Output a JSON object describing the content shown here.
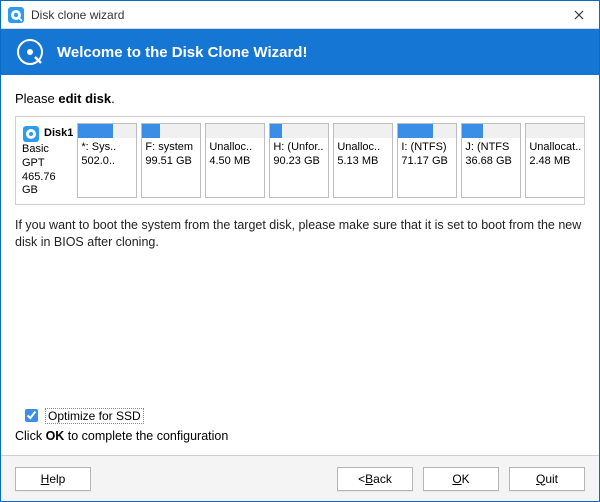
{
  "window": {
    "title": "Disk clone wizard"
  },
  "banner": {
    "title": "Welcome to the Disk Clone Wizard!"
  },
  "instruction": {
    "prefix": "Please ",
    "bold": "edit disk",
    "suffix": "."
  },
  "disk": {
    "name": "Disk1",
    "type": "Basic GPT",
    "size": "465.76 GB"
  },
  "partitions": [
    {
      "label": "*: Sys..",
      "size": "502.0..",
      "fill": 60
    },
    {
      "label": "F: system",
      "size": "99.51 GB",
      "fill": 30
    },
    {
      "label": "Unalloc..",
      "size": "4.50 MB",
      "fill": 0
    },
    {
      "label": "H: (Unfor..",
      "size": "90.23 GB",
      "fill": 20
    },
    {
      "label": "Unalloc..",
      "size": "5.13 MB",
      "fill": 0
    },
    {
      "label": "I: (NTFS)",
      "size": "71.17 GB",
      "fill": 60
    },
    {
      "label": "J: (NTFS",
      "size": "36.68 GB",
      "fill": 35
    },
    {
      "label": "Unallocat..",
      "size": "2.48 MB",
      "fill": 0
    }
  ],
  "note": "If you want to boot the system from the target disk, please make sure that it is set to boot from the new disk in BIOS after cloning.",
  "optimize": {
    "label": "Optimize for SSD",
    "checked": true
  },
  "confirm": {
    "prefix": "Click ",
    "bold": "OK",
    "suffix": " to complete the configuration"
  },
  "buttons": {
    "help": "Help",
    "back": "Back",
    "ok": "OK",
    "quit": "Quit"
  }
}
